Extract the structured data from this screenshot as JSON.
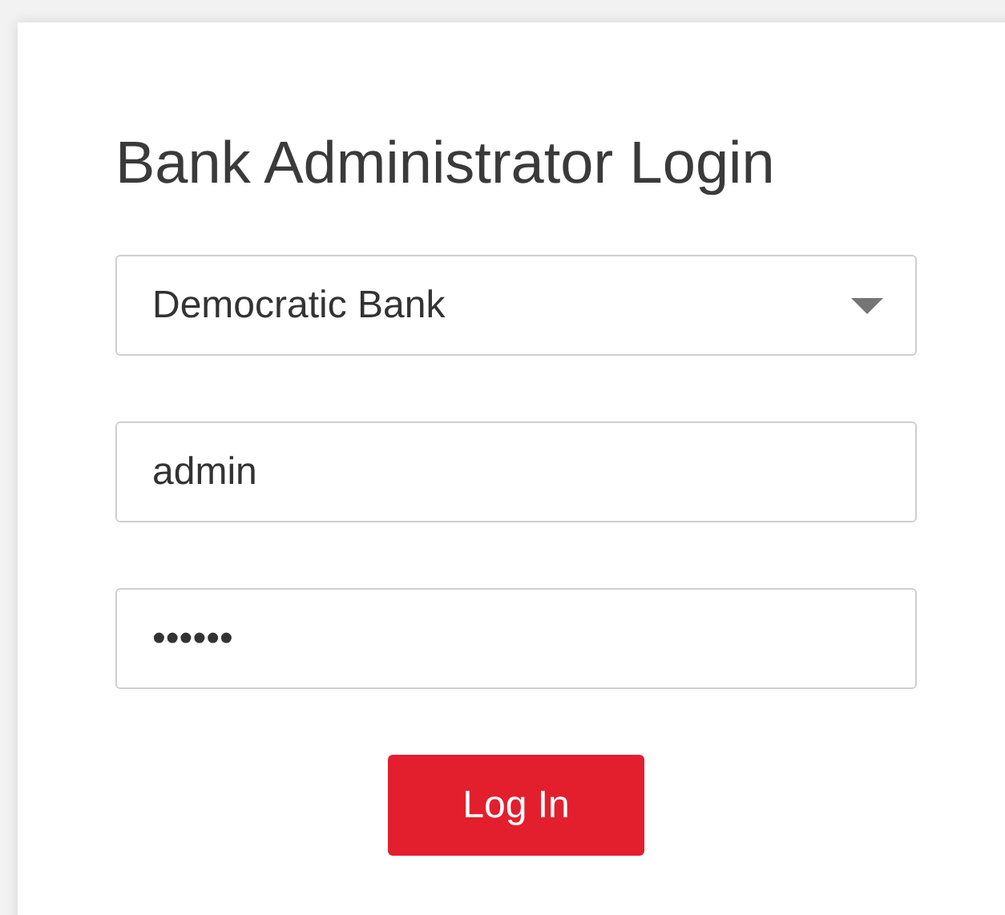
{
  "title": "Bank Administrator Login",
  "bank_select": {
    "value": "Democratic Bank"
  },
  "username": {
    "value": "admin"
  },
  "password": {
    "value": "••••••"
  },
  "login_button": {
    "label": "Log In"
  }
}
